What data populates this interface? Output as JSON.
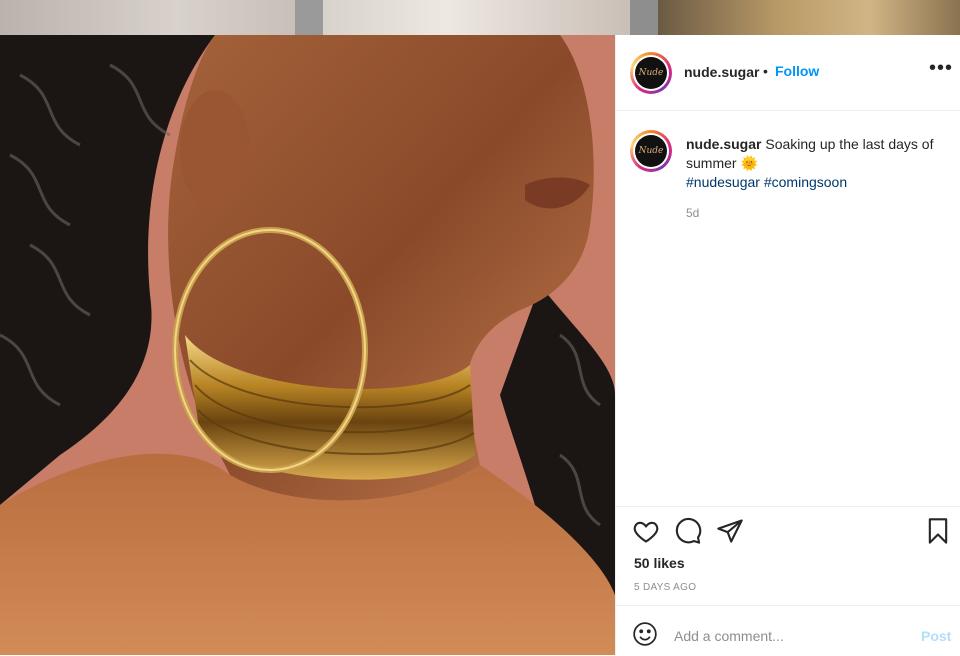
{
  "post": {
    "username": "nude.sugar",
    "follow_label": "Follow",
    "dot": "•",
    "avatar_text": "Nude",
    "more_label": "•••",
    "caption_text": "Soaking up the last days of summer",
    "caption_emoji": "🌞",
    "hashtags": [
      "#nudesugar",
      "#comingsoon"
    ],
    "age": "5d",
    "likes": "50 likes",
    "date_label": "5 DAYS AGO"
  },
  "comment": {
    "placeholder": "Add a comment...",
    "post_label": "Post"
  },
  "colors": {
    "accent": "#0095f6",
    "hashtag": "#00376b",
    "post_disabled": "#b2dffc"
  },
  "icons": [
    "heart-icon",
    "comment-icon",
    "share-icon",
    "bookmark-icon",
    "smile-icon",
    "more-icon"
  ]
}
